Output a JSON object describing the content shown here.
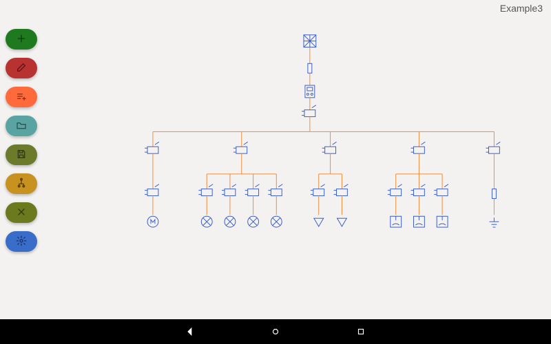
{
  "title": "Example3",
  "toolbar": [
    {
      "name": "add-button",
      "icon": "plus-icon",
      "bg": "#1f7a1f",
      "fg": "#0d3d0d"
    },
    {
      "name": "edit-button",
      "icon": "edit-icon",
      "bg": "#b93232",
      "fg": "#5c1414"
    },
    {
      "name": "list-add-button",
      "icon": "list-add-icon",
      "bg": "#ff6a3d",
      "fg": "#8a2f12"
    },
    {
      "name": "open-button",
      "icon": "folder-icon",
      "bg": "#5aa3a3",
      "fg": "#285454"
    },
    {
      "name": "save-button",
      "icon": "save-icon",
      "bg": "#6b7a2b",
      "fg": "#333b14"
    },
    {
      "name": "hierarchy-button",
      "icon": "hierarchy-icon",
      "bg": "#c7921f",
      "fg": "#5c420b"
    },
    {
      "name": "tools-button",
      "icon": "tools-icon",
      "bg": "#6b7a1f",
      "fg": "#333b0b"
    },
    {
      "name": "settings-button",
      "icon": "gear-icon",
      "bg": "#3a6dc9",
      "fg": "#163063"
    }
  ],
  "diagram": {
    "wire_color": "#f08b3a",
    "symbol_color": "#3a5ec9",
    "root_chain": [
      "source",
      "fuse",
      "meter",
      "breaker"
    ],
    "branches": [
      {
        "breaker": true,
        "children": [
          {
            "breaker": true,
            "load": "motor"
          }
        ]
      },
      {
        "breaker": true,
        "children": [
          {
            "breaker": true,
            "load": "lamp"
          },
          {
            "breaker": true,
            "load": "lamp"
          },
          {
            "breaker": true,
            "load": "lamp"
          },
          {
            "breaker": true,
            "load": "lamp"
          }
        ]
      },
      {
        "breaker": true,
        "children": [
          {
            "breaker": true,
            "load": "arrow"
          },
          {
            "breaker": true,
            "load": "arrow"
          }
        ]
      },
      {
        "breaker": true,
        "children": [
          {
            "breaker": true,
            "load": "socket"
          },
          {
            "breaker": true,
            "load": "socket"
          },
          {
            "breaker": true,
            "load": "socket"
          }
        ]
      },
      {
        "breaker": true,
        "children": [
          {
            "fuse": true,
            "load": "ground"
          }
        ]
      }
    ]
  },
  "nav": {
    "back": "back-icon",
    "home": "circle-icon",
    "overview": "square-icon"
  }
}
